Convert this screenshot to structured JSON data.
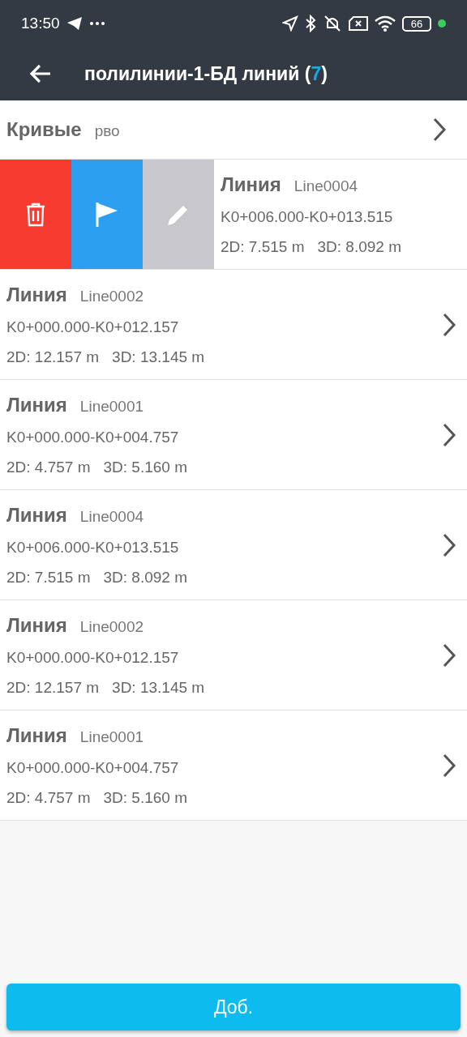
{
  "status_bar": {
    "time": "13:50",
    "battery": "66"
  },
  "app_bar": {
    "title_start": "полилинии-1-БД линий (",
    "count": "7",
    "title_end": ")"
  },
  "folder": {
    "title": "Кривые",
    "subtitle": "рво"
  },
  "lines": [
    {
      "title": "Линия",
      "code": "Line0004",
      "range": "K0+006.000-K0+013.515",
      "length_2d": "2D: 7.515 m",
      "length_3d": "3D: 8.092 m",
      "swiped": true
    },
    {
      "title": "Линия",
      "code": "Line0002",
      "range": "K0+000.000-K0+012.157",
      "length_2d": "2D: 12.157 m",
      "length_3d": "3D: 13.145 m",
      "swiped": false
    },
    {
      "title": "Линия",
      "code": "Line0001",
      "range": "K0+000.000-K0+004.757",
      "length_2d": "2D: 4.757 m",
      "length_3d": "3D: 5.160 m",
      "swiped": false
    },
    {
      "title": "Линия",
      "code": "Line0004",
      "range": "K0+006.000-K0+013.515",
      "length_2d": "2D: 7.515 m",
      "length_3d": "3D: 8.092 m",
      "swiped": false
    },
    {
      "title": "Линия",
      "code": "Line0002",
      "range": "K0+000.000-K0+012.157",
      "length_2d": "2D: 12.157 m",
      "length_3d": "3D: 13.145 m",
      "swiped": false
    },
    {
      "title": "Линия",
      "code": "Line0001",
      "range": "K0+000.000-K0+004.757",
      "length_2d": "2D: 4.757 m",
      "length_3d": "3D: 5.160 m",
      "swiped": false
    }
  ],
  "add_button": "Доб."
}
